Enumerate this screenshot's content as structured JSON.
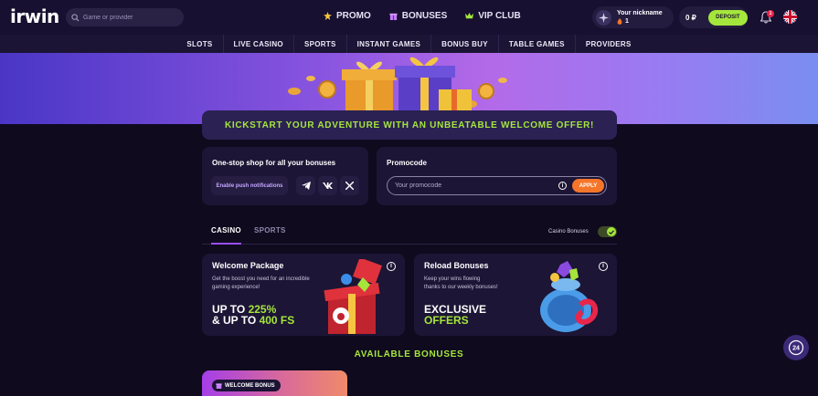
{
  "header": {
    "logo": "irwin",
    "search_placeholder": "Game or provider",
    "nav": [
      {
        "label": "PROMO",
        "icon": "star-icon",
        "color": "#f5c542"
      },
      {
        "label": "BONUSES",
        "icon": "gift-icon",
        "color": "#c77dff"
      },
      {
        "label": "VIP CLUB",
        "icon": "crown-icon",
        "color": "#a5e63c"
      }
    ],
    "user": {
      "nickname": "Your nickname",
      "level": "1"
    },
    "balance": "0 ₽",
    "deposit_label": "DEPOSIT",
    "notifications_count": "1"
  },
  "categories": [
    "SLOTS",
    "LIVE CASINO",
    "SPORTS",
    "INSTANT GAMES",
    "BONUS BUY",
    "TABLE GAMES",
    "PROVIDERS"
  ],
  "welcome_banner": "KICKSTART YOUR ADVENTURE WITH AN UNBEATABLE WELCOME OFFER!",
  "shop_card": {
    "title": "One-stop shop for all your bonuses",
    "push_label": "Enable push notifications"
  },
  "promo_card": {
    "title": "Promocode",
    "placeholder": "Your promocode",
    "apply_label": "APPLY"
  },
  "tabs": {
    "items": [
      "CASINO",
      "SPORTS"
    ],
    "active": "CASINO",
    "toggle_label": "Casino Bonuses",
    "toggle_on": true
  },
  "bonus_cards": [
    {
      "title": "Welcome Package",
      "desc_line1": "Get the boost you need for an incredible",
      "desc_line2": "gaming experience!",
      "big_line1_prefix": "UP TO ",
      "big_line1_accent": "225%",
      "big_line2_prefix": "& UP TO ",
      "big_line2_accent": "400 FS"
    },
    {
      "title": "Reload Bonuses",
      "desc_line1": "Keep your wins flowing",
      "desc_line2": "thanks to our weekly bonuses!",
      "big_line1": "EXCLUSIVE",
      "big_line2": "OFFERS"
    }
  ],
  "available_title": "AVAILABLE BONUSES",
  "bottom_card_chip": "WELCOME BONUS",
  "support_label": "24",
  "colors": {
    "accent_green": "#a5e63c",
    "accent_orange": "#f5762a",
    "bg": "#0f0a1e",
    "card": "#1c1535"
  }
}
